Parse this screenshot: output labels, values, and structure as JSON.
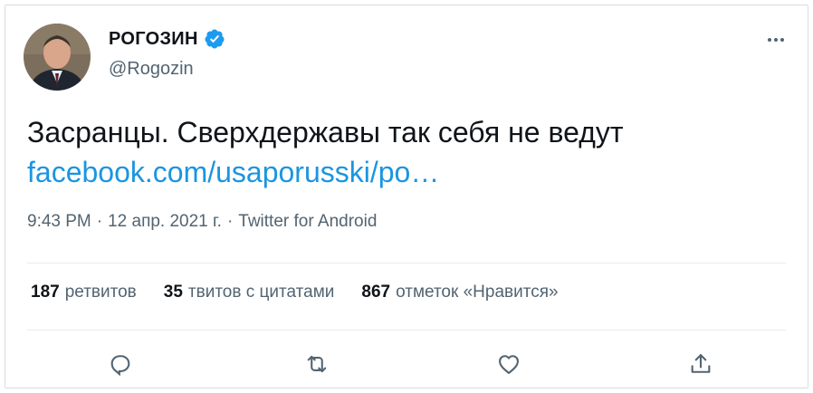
{
  "author": {
    "display_name": "РОГОЗИН",
    "handle": "@Rogozin",
    "avatar_icon": "profile-photo",
    "verified_icon": "verified-badge-icon",
    "verified_color": "#1d9bf0"
  },
  "tweet": {
    "text": "Засранцы. Сверхдержавы так себя не ведут",
    "link_text": "facebook.com/usaporusski/po…",
    "link_color": "#1b95e0"
  },
  "meta": {
    "time": "9:43 PM",
    "sep1": "·",
    "date": "12 апр. 2021 г.",
    "sep2": "·",
    "source": "Twitter for Android"
  },
  "stats": {
    "retweets": {
      "count": "187",
      "label": "ретвитов"
    },
    "quotes": {
      "count": "35",
      "label": "твитов с цитатами"
    },
    "likes": {
      "count": "867",
      "label": "отметок «Нравится»"
    }
  },
  "actions": [
    "reply-icon",
    "retweet-icon",
    "like-icon",
    "share-icon"
  ],
  "colors": {
    "text_primary": "#0f1419",
    "text_secondary": "#536471",
    "border": "#d8dde1"
  }
}
